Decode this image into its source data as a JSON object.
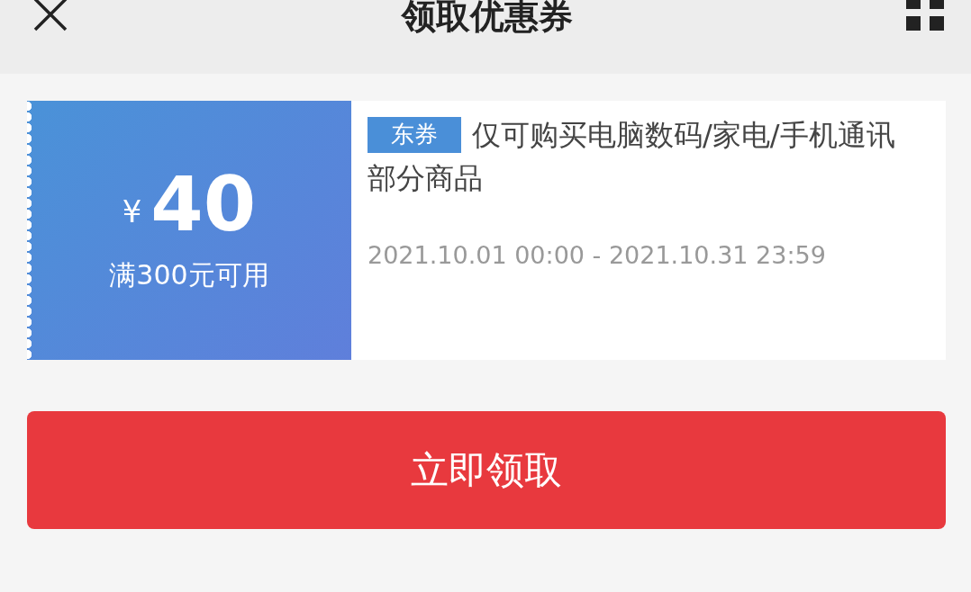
{
  "header": {
    "title": "领取优惠券"
  },
  "coupon": {
    "currency": "¥",
    "amount": "40",
    "condition": "满300元可用",
    "tag": "东券",
    "description_lines": [
      "仅可购买电脑数码/家电/手机通讯",
      "部分商品"
    ],
    "validity": "2021.10.01 00:00 - 2021.10.31 23:59"
  },
  "action_button": {
    "label": "立即领取"
  }
}
